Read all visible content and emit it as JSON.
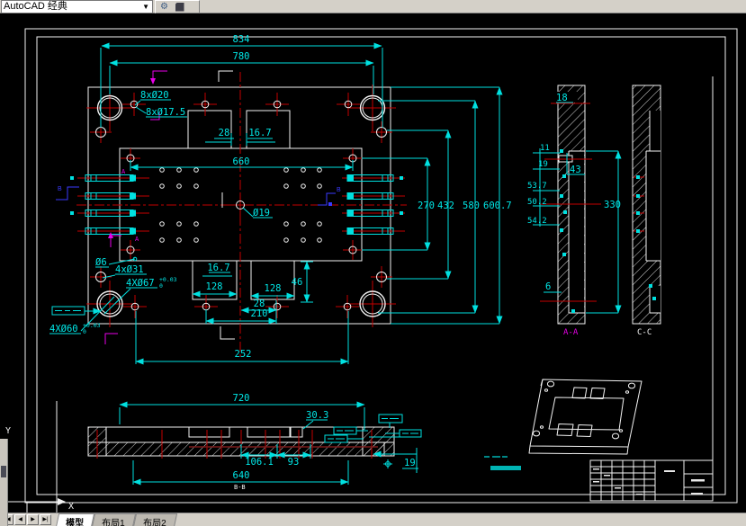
{
  "toolbar": {
    "workspace_value": "AutoCAD 经典",
    "dropdown_arrow": "▼"
  },
  "model_tabs": {
    "nav": [
      "|◀",
      "◀",
      "▶",
      "▶|"
    ],
    "items": [
      "模型",
      "布局1",
      "布局2"
    ]
  },
  "ucs": {
    "x": "X",
    "y": "Y"
  },
  "colors": {
    "dimension": "#00e0e0",
    "geometry": "#f2f2f2",
    "centerline": "#c40000",
    "section_marker": "#e800e8"
  },
  "plan": {
    "dim_834": "834",
    "dim_780": "780",
    "dim_28_top": "28",
    "dim_167_top": "16.7",
    "dim_660": "660",
    "label_8xd20": "8xØ20",
    "label_8xd175": "8xØ17.5",
    "label_d19": "Ø19",
    "label_d6": "Ø6",
    "label_4xd31": "4xØ31",
    "label_4xd67": "4XØ67",
    "label_4xd60": "4XØ60",
    "tol_plus": "+0.03",
    "tol_zero": "0",
    "dim_167_bottom": "16.7",
    "dim_128_left": "128",
    "dim_128_right": "128",
    "dim_46": "46",
    "dim_28_bottom": "28",
    "dim_210": "210",
    "dim_252": "252",
    "dim_270": "270",
    "dim_432": "432",
    "dim_580": "580",
    "dim_6007": "600.7",
    "marker_a": "A",
    "marker_b": "B"
  },
  "section_a": {
    "dim_18": "18",
    "dim_11": "11",
    "dim_19": "19",
    "dim_43": "43",
    "dim_537": "53.7",
    "dim_502": "50.2",
    "dim_542": "54.2",
    "dim_330": "330",
    "dim_6": "6",
    "label": "A-A"
  },
  "section_c": {
    "label": "C-C"
  },
  "bottom_view": {
    "dim_720": "720",
    "dim_303": "30.3",
    "dim_1061": "106.1",
    "dim_93": "93",
    "dim_640": "640",
    "dim_19": "19",
    "label": "B-B"
  }
}
